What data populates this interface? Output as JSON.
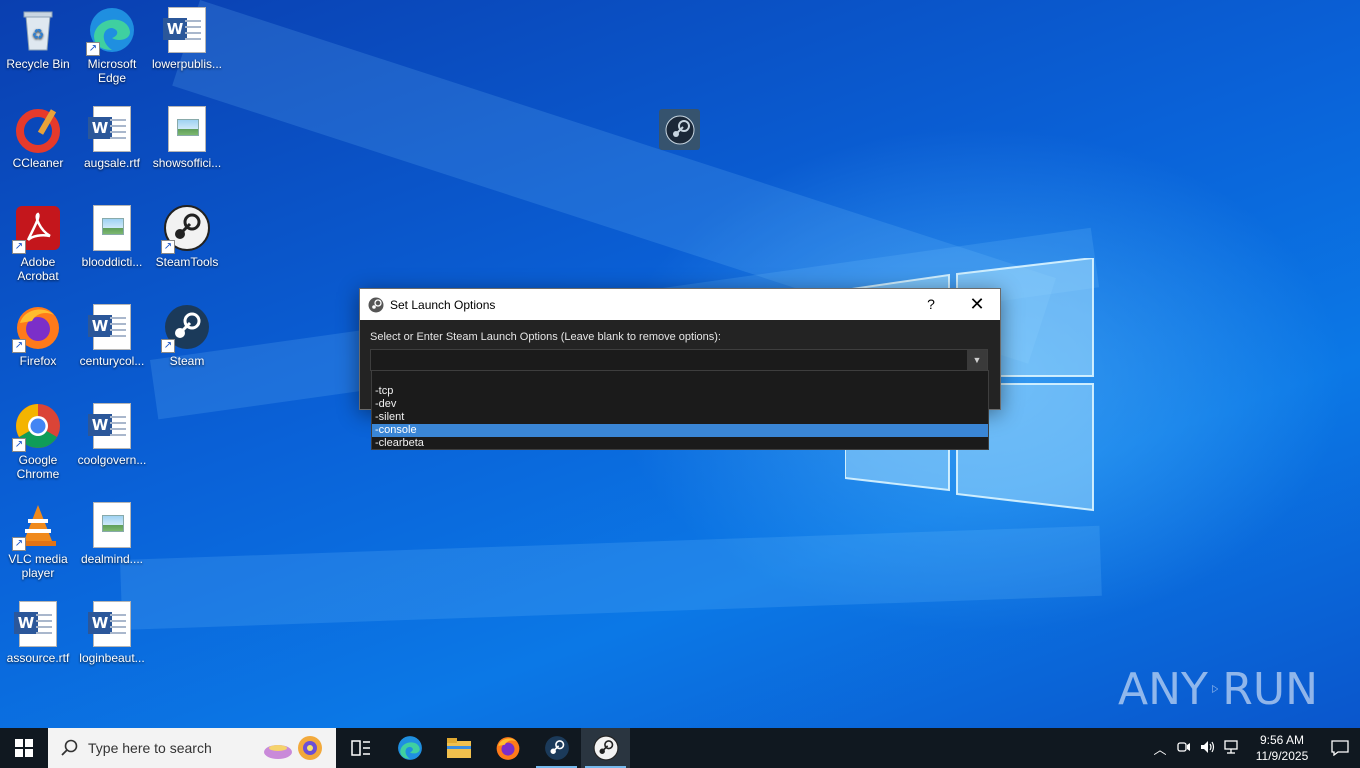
{
  "desktop": {
    "icons": [
      {
        "label": "Recycle Bin",
        "icon": "recycle-bin-icon"
      },
      {
        "label": "Microsoft Edge",
        "icon": "edge-icon"
      },
      {
        "label": "lowerpublis...",
        "icon": "word-doc-icon"
      },
      {
        "label": "CCleaner",
        "icon": "ccleaner-icon"
      },
      {
        "label": "augsale.rtf",
        "icon": "word-doc-icon"
      },
      {
        "label": "showsoffici...",
        "icon": "image-file-icon"
      },
      {
        "label": "Adobe Acrobat",
        "icon": "acrobat-icon"
      },
      {
        "label": "blooddicti...",
        "icon": "image-file-icon"
      },
      {
        "label": "SteamTools",
        "icon": "steamtools-icon"
      },
      {
        "label": "Firefox",
        "icon": "firefox-icon"
      },
      {
        "label": "centurycol...",
        "icon": "word-doc-icon"
      },
      {
        "label": "Steam",
        "icon": "steam-icon"
      },
      {
        "label": "Google Chrome",
        "icon": "chrome-icon"
      },
      {
        "label": "coolgovern...",
        "icon": "word-doc-icon"
      },
      {
        "label": "VLC media player",
        "icon": "vlc-icon"
      },
      {
        "label": "dealmind....",
        "icon": "image-file-icon"
      },
      {
        "label": "assource.rtf",
        "icon": "word-doc-icon"
      },
      {
        "label": "loginbeaut...",
        "icon": "word-doc-icon"
      }
    ]
  },
  "dialog": {
    "title": "Set Launch Options",
    "help_label": "?",
    "close_label": "✕",
    "prompt": "Select or Enter Steam Launch Options (Leave blank to remove options):",
    "input_value": "",
    "dropdown_arrow": "▼",
    "options": [
      "-tcp",
      "-dev",
      "-silent",
      "-console",
      "-clearbeta"
    ],
    "selected_option": "-console"
  },
  "taskbar": {
    "search_placeholder": "Type here to search",
    "apps": [
      "task-view-icon",
      "edge-icon",
      "file-explorer-icon",
      "firefox-icon",
      "steam-icon",
      "steamtools-icon"
    ],
    "time": "9:56 AM",
    "date": "11/9/2025"
  },
  "watermark": {
    "left": "ANY",
    "right": "RUN"
  },
  "colors": {
    "selection": "#3a86d6",
    "dialog_bg": "#232323",
    "taskbar": "#101820"
  }
}
